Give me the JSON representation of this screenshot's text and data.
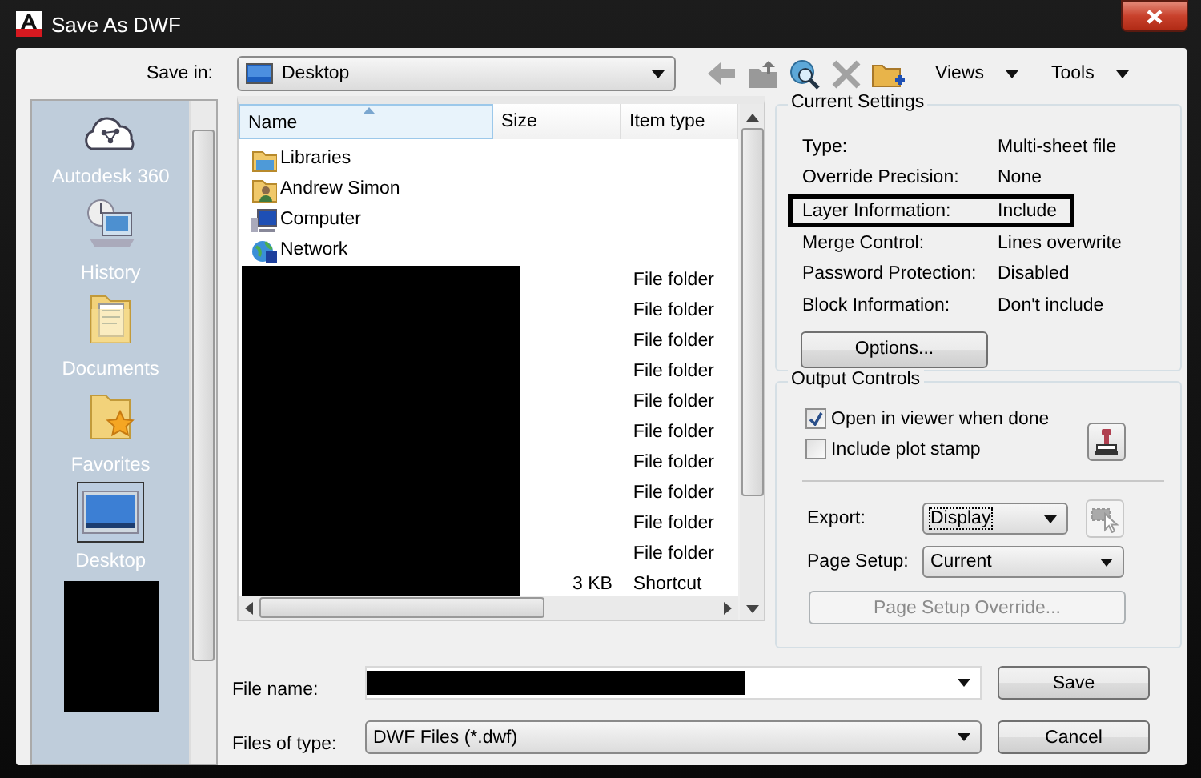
{
  "window": {
    "title": "Save As DWF"
  },
  "save_in": {
    "label": "Save in:",
    "value": "Desktop"
  },
  "toolbar": [
    {
      "kind": "back",
      "disabled": true
    },
    {
      "kind": "up_folder",
      "disabled": false
    },
    {
      "kind": "search_web",
      "disabled": false
    },
    {
      "kind": "delete",
      "disabled": true
    },
    {
      "kind": "new_folder",
      "disabled": false
    }
  ],
  "menus": [
    {
      "label": "Views"
    },
    {
      "label": "Tools"
    }
  ],
  "places": [
    {
      "kind": "cloud",
      "label": "Autodesk 360",
      "selected": false
    },
    {
      "kind": "history",
      "label": "History",
      "selected": false
    },
    {
      "kind": "documents",
      "label": "Documents",
      "selected": false
    },
    {
      "kind": "favorites",
      "label": "Favorites",
      "selected": false
    },
    {
      "kind": "desktop",
      "label": "Desktop",
      "selected": true
    },
    {
      "kind": "redacted",
      "selected": false
    }
  ],
  "file_list": {
    "columns": [
      "Name",
      "Size",
      "Item type"
    ],
    "rows": [
      {
        "kind": "libraries",
        "name": "Libraries"
      },
      {
        "kind": "user",
        "name": "Andrew Simon"
      },
      {
        "kind": "computer",
        "name": "Computer"
      },
      {
        "kind": "network",
        "name": "Network"
      },
      {
        "kind": "redacted",
        "item_type": "File folder"
      },
      {
        "kind": "redacted",
        "item_type": "File folder"
      },
      {
        "kind": "redacted",
        "item_type": "File folder"
      },
      {
        "kind": "redacted",
        "item_type": "File folder"
      },
      {
        "kind": "redacted",
        "item_type": "File folder"
      },
      {
        "kind": "redacted",
        "item_type": "File folder"
      },
      {
        "kind": "redacted",
        "item_type": "File folder"
      },
      {
        "kind": "redacted",
        "item_type": "File folder"
      },
      {
        "kind": "redacted",
        "item_type": "File folder"
      },
      {
        "kind": "redacted",
        "item_type": "File folder"
      },
      {
        "kind": "redacted",
        "size": "3 KB",
        "item_type": "Shortcut"
      }
    ]
  },
  "current_settings": {
    "title": "Current Settings",
    "rows": [
      {
        "label": "Type:",
        "value": "Multi-sheet file",
        "highlighted": false
      },
      {
        "label": "Override Precision:",
        "value": "None",
        "highlighted": false
      },
      {
        "label": "Layer Information:",
        "value": "Include",
        "highlighted": true
      },
      {
        "label": "Merge Control:",
        "value": "Lines overwrite",
        "highlighted": false
      },
      {
        "label": "Password Protection:",
        "value": "Disabled",
        "highlighted": false
      },
      {
        "label": "Block Information:",
        "value": "Don't include",
        "highlighted": false
      }
    ],
    "button": "Options..."
  },
  "output_controls": {
    "title": "Output Controls",
    "checkboxes": [
      {
        "label": "Open in viewer when done",
        "checked": true
      },
      {
        "label": "Include plot stamp",
        "checked": false
      }
    ],
    "export": {
      "label": "Export:",
      "value": "Display"
    },
    "page_setup": {
      "label": "Page Setup:",
      "value": "Current"
    },
    "override_button": {
      "label": "Page Setup Override...",
      "disabled": true
    }
  },
  "file_name": {
    "label": "File name:",
    "redacted": true
  },
  "file_type": {
    "label": "Files of type:",
    "value": "DWF Files (*.dwf)"
  },
  "buttons": [
    {
      "label": "Save"
    },
    {
      "label": "Cancel"
    }
  ]
}
